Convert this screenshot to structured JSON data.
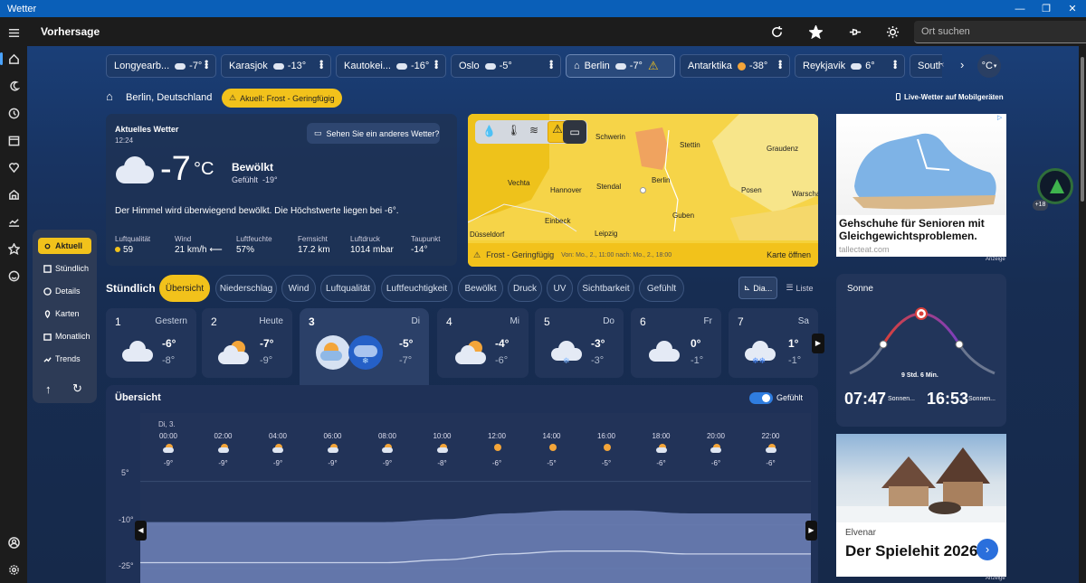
{
  "window": {
    "title": "Wetter",
    "controls": [
      "—",
      "❐",
      "✕"
    ]
  },
  "header": {
    "title": "Vorhersage",
    "search_placeholder": "Ort suchen"
  },
  "rail": {
    "icons": [
      "menu-icon",
      "home-icon",
      "moon-icon",
      "history-icon",
      "calendar-icon",
      "heart-icon",
      "house-icon",
      "graph-icon",
      "star-icon",
      "smiley-icon",
      "account-icon",
      "settings-icon"
    ]
  },
  "locations": [
    {
      "name": "Longyearb...",
      "temp": "-7°"
    },
    {
      "name": "Karasjok",
      "temp": "-13°"
    },
    {
      "name": "Kautokei...",
      "temp": "-16°"
    },
    {
      "name": "Oslo",
      "temp": "-5°"
    },
    {
      "name": "Berlin",
      "temp": "-7°",
      "active": true
    },
    {
      "name": "Antarktika",
      "temp": "-38°"
    },
    {
      "name": "Reykjavik",
      "temp": "6°"
    },
    {
      "name": "South",
      "temp": ""
    }
  ],
  "unit_button": "°C",
  "location_bar": {
    "place": "Berlin, Deutschland",
    "alert": "Akuell: Frost - Geringfügig",
    "mobile": "Live-Wetter auf Mobilgeräten"
  },
  "nav": {
    "items": [
      "Aktuell",
      "Stündlich",
      "Details",
      "Karten",
      "Monatlich",
      "Trends"
    ]
  },
  "current": {
    "title": "Aktuelles Wetter",
    "time": "12:24",
    "other_weather": "Sehen Sie ein anderes Wetter?",
    "temp": "-7",
    "unit": "°C",
    "condition": "Bewölkt",
    "feels_label": "Gefühlt",
    "feels": "-19°",
    "summary": "Der Himmel wird überwiegend bewölkt. Die Höchstwerte liegen bei -6°.",
    "details": [
      {
        "label": "Luftqualität",
        "value": "59"
      },
      {
        "label": "Wind",
        "value": "21 km/h"
      },
      {
        "label": "Luftfeuchte",
        "value": "57%"
      },
      {
        "label": "Fernsicht",
        "value": "17.2 km"
      },
      {
        "label": "Luftdruck",
        "value": "1014 mbar"
      },
      {
        "label": "Taupunkt",
        "value": "-14°"
      }
    ]
  },
  "map": {
    "cities": [
      "Schwerin",
      "Stettin",
      "Graudenz",
      "Vechta",
      "Hannover",
      "Stendal",
      "Berlin",
      "Posen",
      "Warscha",
      "Einbeck",
      "Guben",
      "Düsseldorf",
      "Leipzig"
    ],
    "alert": "Frost - Geringfügig",
    "alert_time": "Von: Mo., 2., 11:00 nach: Mo., 2., 18:00",
    "open": "Karte öffnen"
  },
  "ad1": {
    "headline": "Gehschuhe für Senioren mit Gleichgewichtsproblemen.",
    "domain": "tallecteat.com",
    "tag": "Anzeige"
  },
  "hourly_tabs": {
    "title": "Stündlich",
    "tabs": [
      "Übersicht",
      "Niederschlag",
      "Wind",
      "Luftqualität",
      "Luftfeuchtigkeit",
      "Bewölkt",
      "Druck",
      "UV",
      "Sichtbarkeit",
      "Gefühlt"
    ],
    "view_diagram": "Dia...",
    "view_list": "Liste"
  },
  "days": [
    {
      "num": "1",
      "label": "Gestern",
      "hi": "-6°",
      "lo": "-8°"
    },
    {
      "num": "2",
      "label": "Heute",
      "hi": "-7°",
      "lo": "-9°"
    },
    {
      "num": "3",
      "label": "Di",
      "hi": "-5°",
      "lo": "-7°"
    },
    {
      "num": "4",
      "label": "Mi",
      "hi": "-4°",
      "lo": "-6°"
    },
    {
      "num": "5",
      "label": "Do",
      "hi": "-3°",
      "lo": "-3°"
    },
    {
      "num": "6",
      "label": "Fr",
      "hi": "0°",
      "lo": "-1°"
    },
    {
      "num": "7",
      "label": "Sa",
      "hi": "1°",
      "lo": "-1°"
    }
  ],
  "sun": {
    "title": "Sonne",
    "duration": "9 Std. 6 Min.",
    "rise": "07:47",
    "rise_label": "Sonnen...",
    "set": "16:53",
    "set_label": "Sonnen..."
  },
  "ad2": {
    "brand": "Elvenar",
    "headline": "Der Spielehit 2026!",
    "tag": "Anzeige"
  },
  "overview": {
    "title": "Übersicht",
    "toggle": "Gefühlt",
    "date_label": "Di, 3.",
    "hours": [
      "00:00",
      "02:00",
      "04:00",
      "06:00",
      "08:00",
      "10:00",
      "12:00",
      "14:00",
      "16:00",
      "18:00",
      "20:00",
      "22:00"
    ],
    "temps": [
      "-9°",
      "-9°",
      "-9°",
      "-9°",
      "-9°",
      "-8°",
      "-6°",
      "-5°",
      "-5°",
      "-6°",
      "-6°",
      "-6°"
    ],
    "y_ticks": [
      "5°",
      "-10°",
      "-25°"
    ]
  },
  "chart_data": {
    "type": "area",
    "x": [
      "00:00",
      "02:00",
      "04:00",
      "06:00",
      "08:00",
      "10:00",
      "12:00",
      "14:00",
      "16:00",
      "18:00",
      "20:00",
      "22:00"
    ],
    "series": [
      {
        "values": [
          -9,
          -9,
          -9,
          -9,
          -9,
          -8,
          -6,
          -5,
          -5,
          -6,
          -6,
          -6
        ]
      }
    ],
    "ylim": [
      -30,
      8
    ],
    "y_ticks": [
      5,
      -10,
      -25
    ]
  }
}
